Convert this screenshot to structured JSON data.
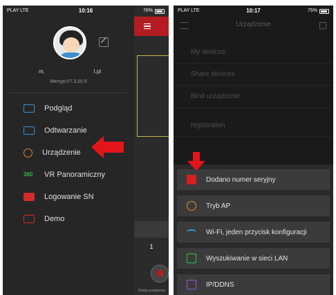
{
  "left_phone": {
    "status": {
      "carrier": "PLAY LTE",
      "time": "10:16",
      "battery": "76%"
    },
    "profile": {
      "name_left": "m.",
      "name_right": "l.pl",
      "version": "Wersja:V7.3.50.5"
    },
    "menu": [
      {
        "label": "Podgląd",
        "icon": "preview-icon"
      },
      {
        "label": "Odtwarzanie",
        "icon": "playback-icon"
      },
      {
        "label": "Urządzenie",
        "icon": "device-gear-icon"
      },
      {
        "label": "VR Panoramiczny",
        "icon": "vr-360-icon"
      },
      {
        "label": "Logowanie SN",
        "icon": "sn-login-icon"
      },
      {
        "label": "Demo",
        "icon": "demo-icon"
      }
    ],
    "strip": {
      "number": "1",
      "caption": "Dodaj urządzenie"
    }
  },
  "right_phone": {
    "status": {
      "carrier": "PLAY LTE",
      "time": "10:17",
      "battery": "75%"
    },
    "header": {
      "title": "Urządzenie"
    },
    "background_items": [
      "My devices",
      "Share devices",
      "Bind urządzenie",
      "registration"
    ],
    "options": [
      {
        "label": "Dodano numer seryjny",
        "icon": "serial-number-icon"
      },
      {
        "label": "Tryb AP",
        "icon": "ap-mode-icon"
      },
      {
        "label": "Wi-Fi, jeden przycisk konfiguracji",
        "icon": "wifi-icon"
      },
      {
        "label": "Wyszukiwanie w sieci LAN",
        "icon": "lan-search-icon"
      },
      {
        "label": "IP/DDNS",
        "icon": "ip-ddns-icon"
      }
    ]
  },
  "colors": {
    "accent_red": "#e3151a",
    "header_red": "#b31d22"
  }
}
